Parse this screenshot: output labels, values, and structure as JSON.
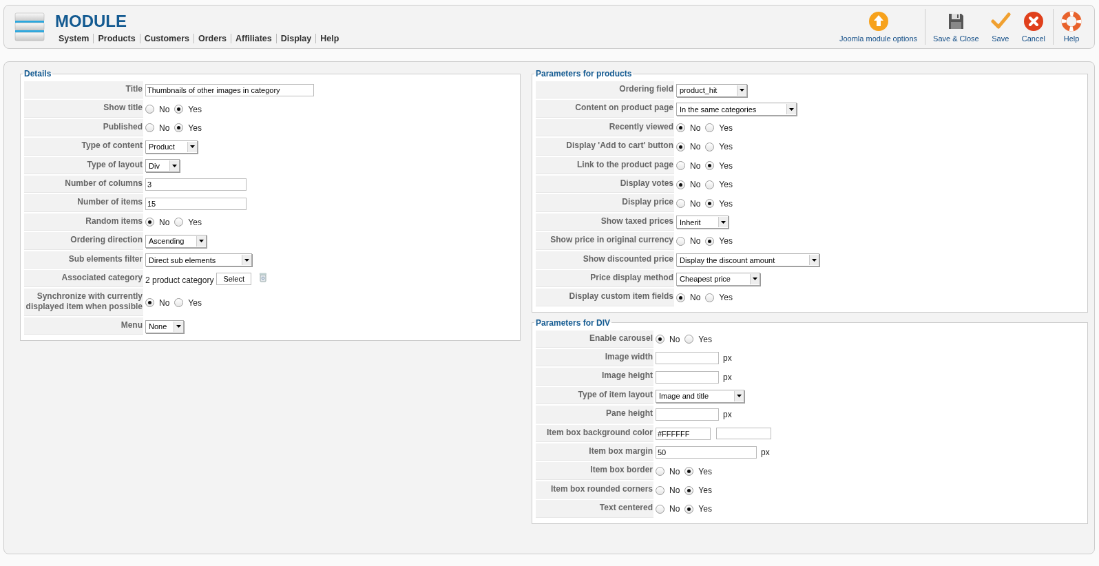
{
  "header": {
    "title": "MODULE",
    "menu": [
      "System",
      "Products",
      "Customers",
      "Orders",
      "Affiliates",
      "Display",
      "Help"
    ]
  },
  "toolbar": [
    {
      "label": "Joomla module options",
      "kind": "options"
    },
    {
      "label": "Save & Close",
      "kind": "save-close"
    },
    {
      "label": "Save",
      "kind": "save"
    },
    {
      "label": "Cancel",
      "kind": "cancel"
    },
    {
      "label": "Help",
      "kind": "help"
    }
  ],
  "details": {
    "title": "Details",
    "rows": [
      {
        "label": "Title",
        "kind": "text",
        "value": "Thumbnails of other images in category"
      },
      {
        "label": "Show title",
        "kind": "radio",
        "options": [
          {
            "label": "No",
            "selected": false
          },
          {
            "label": "Yes",
            "selected": true
          }
        ]
      },
      {
        "label": "Published",
        "kind": "radio",
        "options": [
          {
            "label": "No",
            "selected": false
          },
          {
            "label": "Yes",
            "selected": true
          }
        ]
      },
      {
        "label": "Type of content",
        "kind": "select",
        "value": "Product"
      },
      {
        "label": "Type of layout",
        "kind": "select",
        "value": "Div"
      },
      {
        "label": "Number of columns",
        "kind": "text",
        "value": "3"
      },
      {
        "label": "Number of items",
        "kind": "text",
        "value": "15"
      },
      {
        "label": "Random items",
        "kind": "radio",
        "options": [
          {
            "label": "No",
            "selected": true
          },
          {
            "label": "Yes",
            "selected": false
          }
        ]
      },
      {
        "label": "Ordering direction",
        "kind": "select",
        "value": "Ascending"
      },
      {
        "label": "Sub elements filter",
        "kind": "select",
        "value": "Direct sub elements"
      },
      {
        "label": "Associated category",
        "kind": "category",
        "value": "2 product category",
        "button": "Select"
      },
      {
        "label": "Synchronize with currently displayed item when possible",
        "kind": "radio",
        "options": [
          {
            "label": "No",
            "selected": true
          },
          {
            "label": "Yes",
            "selected": false
          }
        ]
      },
      {
        "label": "Menu",
        "kind": "select",
        "value": "None"
      }
    ]
  },
  "products": {
    "title": "Parameters for products",
    "rows": [
      {
        "label": "Ordering field",
        "kind": "select",
        "value": "product_hit"
      },
      {
        "label": "Content on product page",
        "kind": "select",
        "value": "In the same categories"
      },
      {
        "label": "Recently viewed",
        "kind": "radio",
        "options": [
          {
            "label": "No",
            "selected": true
          },
          {
            "label": "Yes",
            "selected": false
          }
        ]
      },
      {
        "label": "Display 'Add to cart' button",
        "kind": "radio",
        "options": [
          {
            "label": "No",
            "selected": true
          },
          {
            "label": "Yes",
            "selected": false
          }
        ]
      },
      {
        "label": "Link to the product page",
        "kind": "radio",
        "options": [
          {
            "label": "No",
            "selected": false
          },
          {
            "label": "Yes",
            "selected": true
          }
        ]
      },
      {
        "label": "Display votes",
        "kind": "radio",
        "options": [
          {
            "label": "No",
            "selected": true
          },
          {
            "label": "Yes",
            "selected": false
          }
        ]
      },
      {
        "label": "Display price",
        "kind": "radio",
        "options": [
          {
            "label": "No",
            "selected": false
          },
          {
            "label": "Yes",
            "selected": true
          }
        ]
      },
      {
        "label": "Show taxed prices",
        "kind": "select",
        "value": "Inherit"
      },
      {
        "label": "Show price in original currency",
        "kind": "radio",
        "options": [
          {
            "label": "No",
            "selected": false
          },
          {
            "label": "Yes",
            "selected": true
          }
        ]
      },
      {
        "label": "Show discounted price",
        "kind": "select",
        "value": "Display the discount amount"
      },
      {
        "label": "Price display method",
        "kind": "select",
        "value": "Cheapest price"
      },
      {
        "label": "Display custom item fields",
        "kind": "radio",
        "options": [
          {
            "label": "No",
            "selected": true
          },
          {
            "label": "Yes",
            "selected": false
          }
        ]
      }
    ]
  },
  "div": {
    "title": "Parameters for DIV",
    "rows": [
      {
        "label": "Enable carousel",
        "kind": "radio",
        "options": [
          {
            "label": "No",
            "selected": true
          },
          {
            "label": "Yes",
            "selected": false
          }
        ]
      },
      {
        "label": "Image width",
        "kind": "text",
        "unit": "px"
      },
      {
        "label": "Image height",
        "kind": "text",
        "unit": "px"
      },
      {
        "label": "Type of item layout",
        "kind": "select",
        "value": "Image and title"
      },
      {
        "label": "Pane height",
        "kind": "text",
        "unit": "px"
      },
      {
        "label": "Item box background color",
        "kind": "color",
        "value": "#FFFFFF"
      },
      {
        "label": "Item box margin",
        "kind": "text",
        "value": "50",
        "unit": "px"
      },
      {
        "label": "Item box border",
        "kind": "radio",
        "options": [
          {
            "label": "No",
            "selected": false
          },
          {
            "label": "Yes",
            "selected": true
          }
        ]
      },
      {
        "label": "Item box rounded corners",
        "kind": "radio",
        "options": [
          {
            "label": "No",
            "selected": false
          },
          {
            "label": "Yes",
            "selected": true
          }
        ]
      },
      {
        "label": "Text centered",
        "kind": "radio",
        "options": [
          {
            "label": "No",
            "selected": false
          },
          {
            "label": "Yes",
            "selected": true
          }
        ]
      }
    ]
  }
}
